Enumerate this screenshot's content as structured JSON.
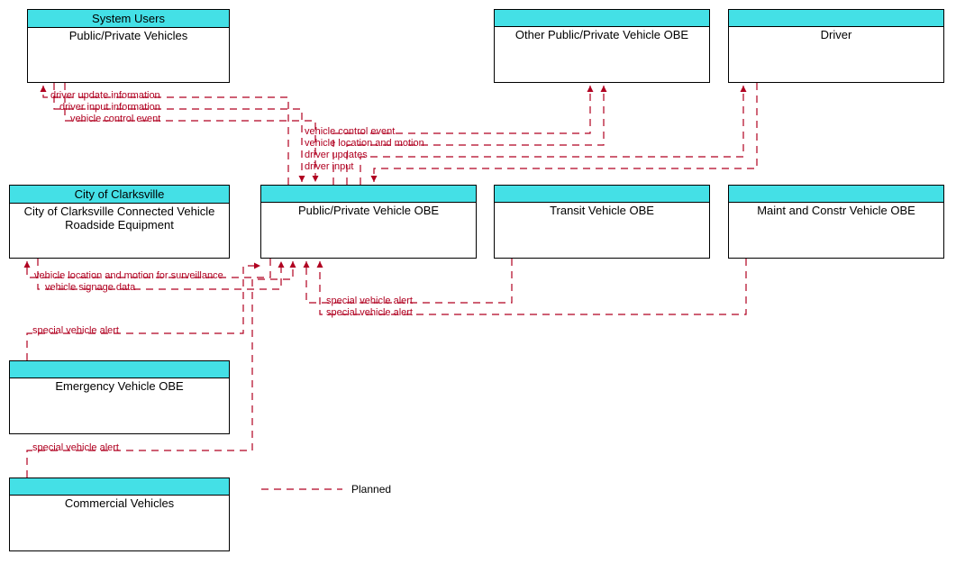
{
  "entities": {
    "system_users": {
      "header": "System Users",
      "body": "Public/Private Vehicles"
    },
    "city_clarksville": {
      "header": "City of Clarksville",
      "body": "City of Clarksville Connected Vehicle Roadside Equipment"
    },
    "public_private_obe": {
      "header": "",
      "body": "Public/Private Vehicle OBE"
    },
    "other_obe": {
      "header": "",
      "body": "Other Public/Private Vehicle OBE"
    },
    "driver": {
      "header": "",
      "body": "Driver"
    },
    "transit_obe": {
      "header": "",
      "body": "Transit Vehicle OBE"
    },
    "maint_obe": {
      "header": "",
      "body": "Maint and Constr Vehicle OBE"
    },
    "emergency_obe": {
      "header": "",
      "body": "Emergency Vehicle OBE"
    },
    "commercial": {
      "header": "",
      "body": "Commercial Vehicles"
    }
  },
  "flows": {
    "driver_update_info": "driver update information",
    "driver_input_info": "driver input information",
    "vehicle_control_event1": "vehicle control event",
    "vehicle_control_event2": "vehicle control event",
    "vehicle_loc_motion": "vehicle location and motion",
    "driver_updates": "driver updates",
    "driver_input": "driver input",
    "vehicle_loc_surv": "vehicle location and motion for surveillance",
    "vehicle_signage": "vehicle signage data",
    "special_alert1": "special vehicle alert",
    "special_alert2": "special vehicle alert",
    "special_alert3": "special vehicle alert",
    "special_alert4": "special vehicle alert"
  },
  "legend": {
    "planned": "Planned"
  },
  "chart_data": {
    "type": "diagram",
    "title": "ITS Architecture Context Diagram – Public/Private Vehicle OBE",
    "focus_entity": "Public/Private Vehicle OBE",
    "entities": [
      {
        "id": "system_users",
        "stakeholder": "System Users",
        "element": "Public/Private Vehicles"
      },
      {
        "id": "city_clarksville",
        "stakeholder": "City of Clarksville",
        "element": "City of Clarksville Connected Vehicle Roadside Equipment"
      },
      {
        "id": "public_private_obe",
        "element": "Public/Private Vehicle OBE"
      },
      {
        "id": "other_obe",
        "element": "Other Public/Private Vehicle OBE"
      },
      {
        "id": "driver",
        "element": "Driver"
      },
      {
        "id": "transit_obe",
        "element": "Transit Vehicle OBE"
      },
      {
        "id": "maint_obe",
        "element": "Maint and Constr Vehicle OBE"
      },
      {
        "id": "emergency_obe",
        "element": "Emergency Vehicle OBE"
      },
      {
        "id": "commercial",
        "element": "Commercial Vehicles"
      }
    ],
    "flows": [
      {
        "from": "public_private_obe",
        "to": "system_users",
        "label": "driver update information",
        "status": "Planned"
      },
      {
        "from": "system_users",
        "to": "public_private_obe",
        "label": "driver input information",
        "status": "Planned"
      },
      {
        "from": "system_users",
        "to": "public_private_obe",
        "label": "vehicle control event",
        "status": "Planned"
      },
      {
        "from": "public_private_obe",
        "to": "other_obe",
        "label": "vehicle control event",
        "status": "Planned"
      },
      {
        "from": "public_private_obe",
        "to": "other_obe",
        "label": "vehicle location and motion",
        "status": "Planned"
      },
      {
        "from": "public_private_obe",
        "to": "driver",
        "label": "driver updates",
        "status": "Planned"
      },
      {
        "from": "driver",
        "to": "public_private_obe",
        "label": "driver input",
        "status": "Planned"
      },
      {
        "from": "public_private_obe",
        "to": "city_clarksville",
        "label": "vehicle location and motion for surveillance",
        "status": "Planned"
      },
      {
        "from": "city_clarksville",
        "to": "public_private_obe",
        "label": "vehicle signage data",
        "status": "Planned"
      },
      {
        "from": "transit_obe",
        "to": "public_private_obe",
        "label": "special vehicle alert",
        "status": "Planned"
      },
      {
        "from": "maint_obe",
        "to": "public_private_obe",
        "label": "special vehicle alert",
        "status": "Planned"
      },
      {
        "from": "emergency_obe",
        "to": "public_private_obe",
        "label": "special vehicle alert",
        "status": "Planned"
      },
      {
        "from": "commercial",
        "to": "public_private_obe",
        "label": "special vehicle alert",
        "status": "Planned"
      }
    ],
    "legend": [
      {
        "style": "dashed",
        "color": "#b00020",
        "label": "Planned"
      }
    ]
  }
}
